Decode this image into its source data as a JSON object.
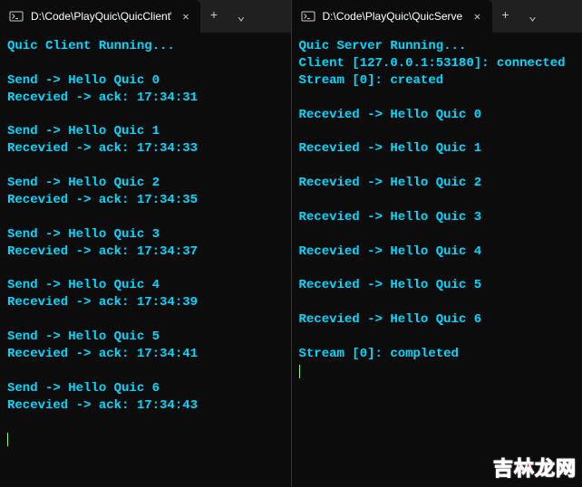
{
  "left": {
    "tab_title": "D:\\Code\\PlayQuic\\QuicClient\\",
    "lines": [
      "Quic Client Running...",
      "",
      "Send -> Hello Quic 0",
      "Recevied -> ack: 17:34:31",
      "",
      "Send -> Hello Quic 1",
      "Recevied -> ack: 17:34:33",
      "",
      "Send -> Hello Quic 2",
      "Recevied -> ack: 17:34:35",
      "",
      "Send -> Hello Quic 3",
      "Recevied -> ack: 17:34:37",
      "",
      "Send -> Hello Quic 4",
      "Recevied -> ack: 17:34:39",
      "",
      "Send -> Hello Quic 5",
      "Recevied -> ack: 17:34:41",
      "",
      "Send -> Hello Quic 6",
      "Recevied -> ack: 17:34:43",
      ""
    ]
  },
  "right": {
    "tab_title": "D:\\Code\\PlayQuic\\QuicServer",
    "lines": [
      "Quic Server Running...",
      "Client [127.0.0.1:53180]: connected",
      "Stream [0]: created",
      "",
      "Recevied -> Hello Quic 0",
      "",
      "Recevied -> Hello Quic 1",
      "",
      "Recevied -> Hello Quic 2",
      "",
      "Recevied -> Hello Quic 3",
      "",
      "Recevied -> Hello Quic 4",
      "",
      "Recevied -> Hello Quic 5",
      "",
      "Recevied -> Hello Quic 6",
      "",
      "Stream [0]: completed"
    ]
  },
  "icons": {
    "close": "✕",
    "plus": "+",
    "chevron_down": "⌄"
  },
  "watermark": "吉林龙网",
  "colors": {
    "terminal_text": "#00d9ff",
    "cursor": "#7fff7f",
    "titlebar": "#202020",
    "tab_active": "#0c0c0c"
  }
}
